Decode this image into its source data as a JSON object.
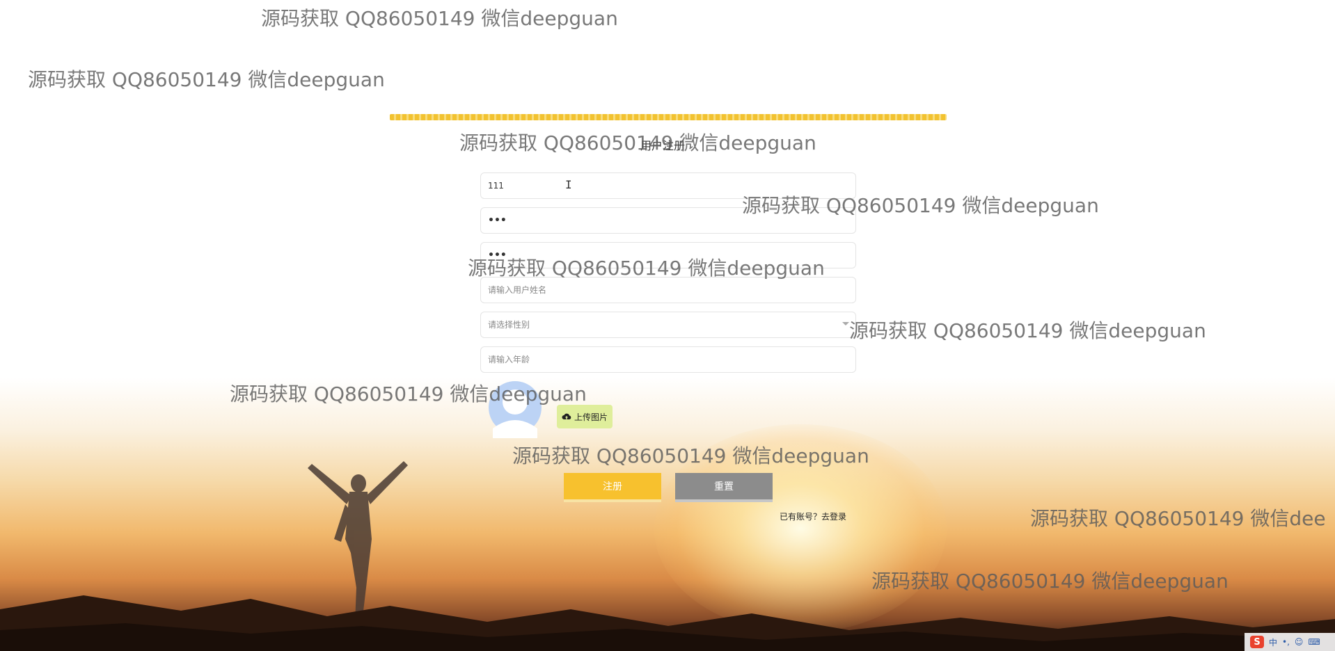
{
  "form": {
    "title": "用户注册",
    "account_value": "111",
    "password_value": "•••",
    "confirm_password_value": "•••",
    "name_placeholder": "请输入用户姓名",
    "gender_placeholder": "请选择性别",
    "age_placeholder": "请输入年龄",
    "upload_label": "上传图片",
    "register_label": "注册",
    "reset_label": "重置",
    "login_link": "已有账号？去登录"
  },
  "watermark_text": "源码获取 QQ86050149 微信deepguan",
  "watermarks": [
    "源码获取 QQ86050149 微信deepguan",
    "源码获取 QQ86050149 微信deepguan",
    "源码获取 QQ86050149 微信deepguan",
    "源码获取 QQ86050149 微信deepguan",
    "源码获取 QQ86050149 微信deepguan",
    "源码获取 QQ86050149 微信deepguan",
    "源码获取 QQ86050149 微信deepguan",
    "源码获取 QQ86050149 微信deepguan",
    "源码获取 QQ86050149 微信deepguan",
    "源码获取 QQ86050149 微信dee"
  ],
  "tray": {
    "ime_logo": "S",
    "ime_mode": "中",
    "punct": "•,",
    "emoji": "☺",
    "keyboard": "⌨"
  },
  "colors": {
    "primary_button": "#f7c12e",
    "reset_button": "#8c8c8c",
    "upload_button": "#dfee9b",
    "band": "#f2c230"
  },
  "icons": {
    "upload": "cloud-upload-icon",
    "avatar": "avatar-placeholder-icon",
    "select": "chevron-down-icon",
    "caret": "text-cursor-icon"
  }
}
